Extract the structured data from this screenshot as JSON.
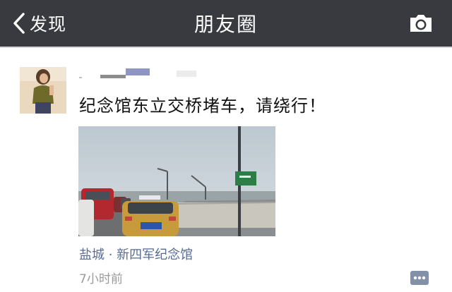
{
  "nav": {
    "back_label": "发现",
    "title": "朋友圈",
    "camera_icon": "camera-icon",
    "bg_color": "#393a3f"
  },
  "post": {
    "text": "纪念馆东立交桥堵车，请绕行！",
    "location": "盐城 · 新四军纪念馆",
    "time": "7小时前",
    "location_color": "#576b95",
    "comment_icon": "comment-icon"
  }
}
